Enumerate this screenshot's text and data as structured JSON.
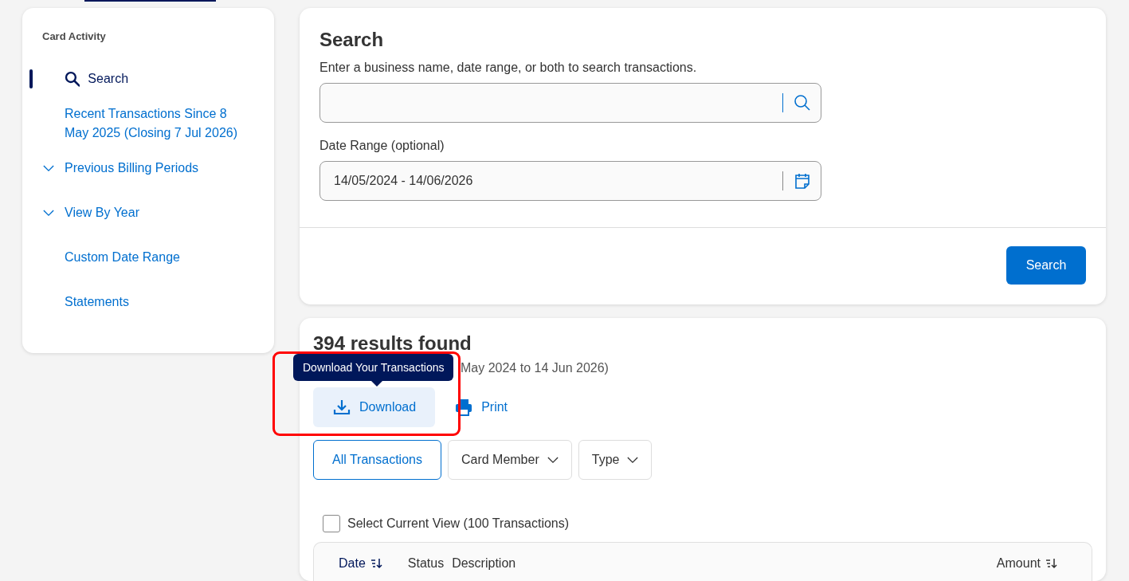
{
  "sidebar": {
    "title": "Card Activity",
    "items": [
      {
        "label": "Search",
        "kind": "search",
        "selected": true
      },
      {
        "label": "Recent Transactions Since 8 May 2025 (Closing 7 Jul 2026)",
        "kind": "link",
        "selected": false
      },
      {
        "label": "Previous Billing Periods",
        "kind": "group",
        "selected": false,
        "expanded": false
      },
      {
        "label": "View By Year",
        "kind": "group",
        "selected": false,
        "expanded": false
      },
      {
        "label": "Custom Date Range",
        "kind": "link",
        "selected": false
      },
      {
        "label": "Statements",
        "kind": "link",
        "selected": false
      }
    ]
  },
  "search": {
    "title": "Search",
    "hint": "Enter a business name, date range, or both to search transactions.",
    "date_label": "Date Range (optional)",
    "date_range": {
      "value": "14/05/2024 - 14/06/2026"
    },
    "button": "Search"
  },
  "results": {
    "title": "394 results found",
    "subtitle": "May 2024 to 14 Jun 2026)",
    "tooltip": "Download Your Transactions",
    "highlighted": true,
    "actions": [
      {
        "label": "Download",
        "kind": "download"
      },
      {
        "label": "Print",
        "kind": "print"
      }
    ],
    "filters": [
      {
        "label": "All Transactions",
        "selected": true,
        "dropdown": false
      },
      {
        "label": "Card Member",
        "selected": false,
        "dropdown": true
      },
      {
        "label": "Type",
        "selected": false,
        "dropdown": true
      }
    ],
    "select_all": {
      "label": "Select Current View (100 Transactions)",
      "checked": false
    },
    "columns": [
      {
        "label": "Date",
        "sortable": true,
        "selected": true
      },
      {
        "label": "Status",
        "sortable": false,
        "selected": false
      },
      {
        "label": "Description",
        "sortable": false,
        "selected": false
      },
      {
        "label": "Amount",
        "sortable": true,
        "selected": false
      }
    ]
  }
}
